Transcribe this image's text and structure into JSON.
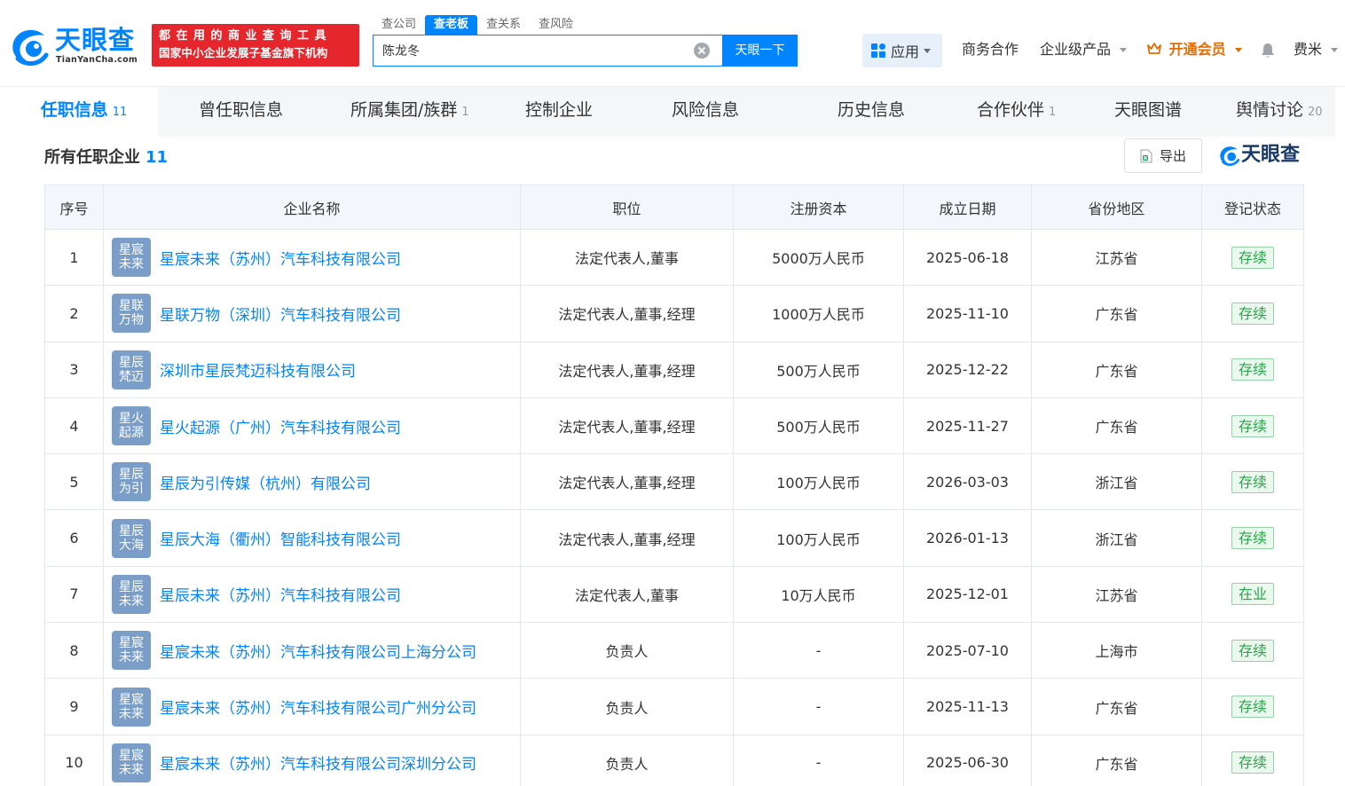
{
  "header": {
    "logo_text": "天眼查",
    "logo_sub": "TianYanCha.com",
    "slogan_line1": "都在用的商业查询工具",
    "slogan_line2": "国家中小企业发展子基金旗下机构",
    "search_tabs": [
      "查公司",
      "查老板",
      "查关系",
      "查风险"
    ],
    "search_value": "陈龙冬",
    "search_button": "天眼一下",
    "nav": {
      "apps": "应用",
      "business": "商务合作",
      "enterprise": "企业级产品",
      "vip": "开通会员",
      "user": "费米"
    },
    "brand_color": "#0084ff"
  },
  "subtabs": [
    {
      "label": "任职信息",
      "count": "11"
    },
    {
      "label": "曾任职信息",
      "count": ""
    },
    {
      "label": "所属集团/族群",
      "count": "1"
    },
    {
      "label": "控制企业",
      "count": ""
    },
    {
      "label": "风险信息",
      "count": ""
    },
    {
      "label": "历史信息",
      "count": ""
    },
    {
      "label": "合作伙伴",
      "count": "1"
    },
    {
      "label": "天眼图谱",
      "count": ""
    },
    {
      "label": "舆情讨论",
      "count": "20"
    }
  ],
  "section": {
    "title": "所有任职企业",
    "count": "11",
    "export": "导出",
    "watermark": "天眼查"
  },
  "table": {
    "columns": [
      "序号",
      "企业名称",
      "职位",
      "注册资本",
      "成立日期",
      "省份地区",
      "登记状态"
    ],
    "rows": [
      {
        "no": "1",
        "logo": [
          "星宸",
          "未来"
        ],
        "name": "星宸未来（苏州）汽车科技有限公司",
        "position": "法定代表人,董事",
        "capital": "5000万人民币",
        "date": "2025-06-18",
        "province": "江苏省",
        "status": "存续"
      },
      {
        "no": "2",
        "logo": [
          "星联",
          "万物"
        ],
        "name": "星联万物（深圳）汽车科技有限公司",
        "position": "法定代表人,董事,经理",
        "capital": "1000万人民币",
        "date": "2025-11-10",
        "province": "广东省",
        "status": "存续"
      },
      {
        "no": "3",
        "logo": [
          "星辰",
          "梵迈"
        ],
        "name": "深圳市星辰梵迈科技有限公司",
        "position": "法定代表人,董事,经理",
        "capital": "500万人民币",
        "date": "2025-12-22",
        "province": "广东省",
        "status": "存续"
      },
      {
        "no": "4",
        "logo": [
          "星火",
          "起源"
        ],
        "name": "星火起源（广州）汽车科技有限公司",
        "position": "法定代表人,董事,经理",
        "capital": "500万人民币",
        "date": "2025-11-27",
        "province": "广东省",
        "status": "存续"
      },
      {
        "no": "5",
        "logo": [
          "星辰",
          "为引"
        ],
        "name": "星辰为引传媒（杭州）有限公司",
        "position": "法定代表人,董事,经理",
        "capital": "100万人民币",
        "date": "2026-03-03",
        "province": "浙江省",
        "status": "存续"
      },
      {
        "no": "6",
        "logo": [
          "星辰",
          "大海"
        ],
        "name": "星辰大海（衢州）智能科技有限公司",
        "position": "法定代表人,董事,经理",
        "capital": "100万人民币",
        "date": "2026-01-13",
        "province": "浙江省",
        "status": "存续"
      },
      {
        "no": "7",
        "logo": [
          "星辰",
          "未来"
        ],
        "name": "星辰未来（苏州）汽车科技有限公司",
        "position": "法定代表人,董事",
        "capital": "10万人民币",
        "date": "2025-12-01",
        "province": "江苏省",
        "status": "在业"
      },
      {
        "no": "8",
        "logo": [
          "星宸",
          "未来"
        ],
        "name": "星宸未来（苏州）汽车科技有限公司上海分公司",
        "position": "负责人",
        "capital": "-",
        "date": "2025-07-10",
        "province": "上海市",
        "status": "存续"
      },
      {
        "no": "9",
        "logo": [
          "星宸",
          "未来"
        ],
        "name": "星宸未来（苏州）汽车科技有限公司广州分公司",
        "position": "负责人",
        "capital": "-",
        "date": "2025-11-13",
        "province": "广东省",
        "status": "存续"
      },
      {
        "no": "10",
        "logo": [
          "星宸",
          "未来"
        ],
        "name": "星宸未来（苏州）汽车科技有限公司深圳分公司",
        "position": "负责人",
        "capital": "-",
        "date": "2025-06-30",
        "province": "广东省",
        "status": "存续"
      }
    ]
  }
}
